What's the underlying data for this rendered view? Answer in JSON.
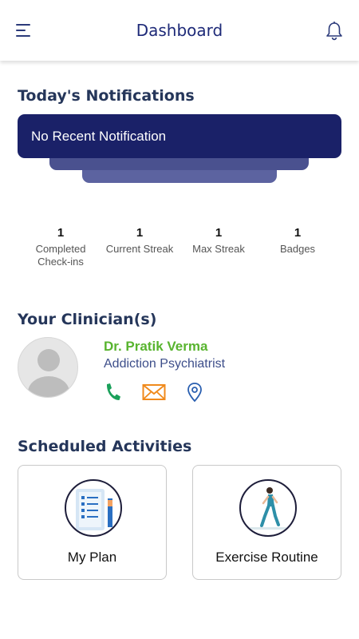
{
  "header": {
    "title": "Dashboard",
    "menu_icon": "hamburger-menu-icon",
    "bell_icon": "bell-icon"
  },
  "notifications": {
    "section_title": "Today's Notifications",
    "message": "No Recent Notification",
    "card_color": "#1a2168"
  },
  "stats": [
    {
      "value": "1",
      "label": "Completed Check-ins"
    },
    {
      "value": "1",
      "label": "Current Streak"
    },
    {
      "value": "1",
      "label": "Max Streak"
    },
    {
      "value": "1",
      "label": "Badges"
    }
  ],
  "clinician": {
    "section_title": "Your Clinician(s)",
    "name": "Dr. Pratik Verma",
    "role": "Addiction Psychiatrist",
    "avatar_icon": "avatar-placeholder-icon",
    "actions": [
      "phone-icon",
      "email-icon",
      "location-pin-icon"
    ],
    "name_color": "#58b42f"
  },
  "activities": {
    "section_title": "Scheduled Activities",
    "items": [
      {
        "label": "My Plan",
        "icon": "checklist-clipboard-icon"
      },
      {
        "label": "Exercise Routine",
        "icon": "running-person-icon"
      }
    ]
  }
}
